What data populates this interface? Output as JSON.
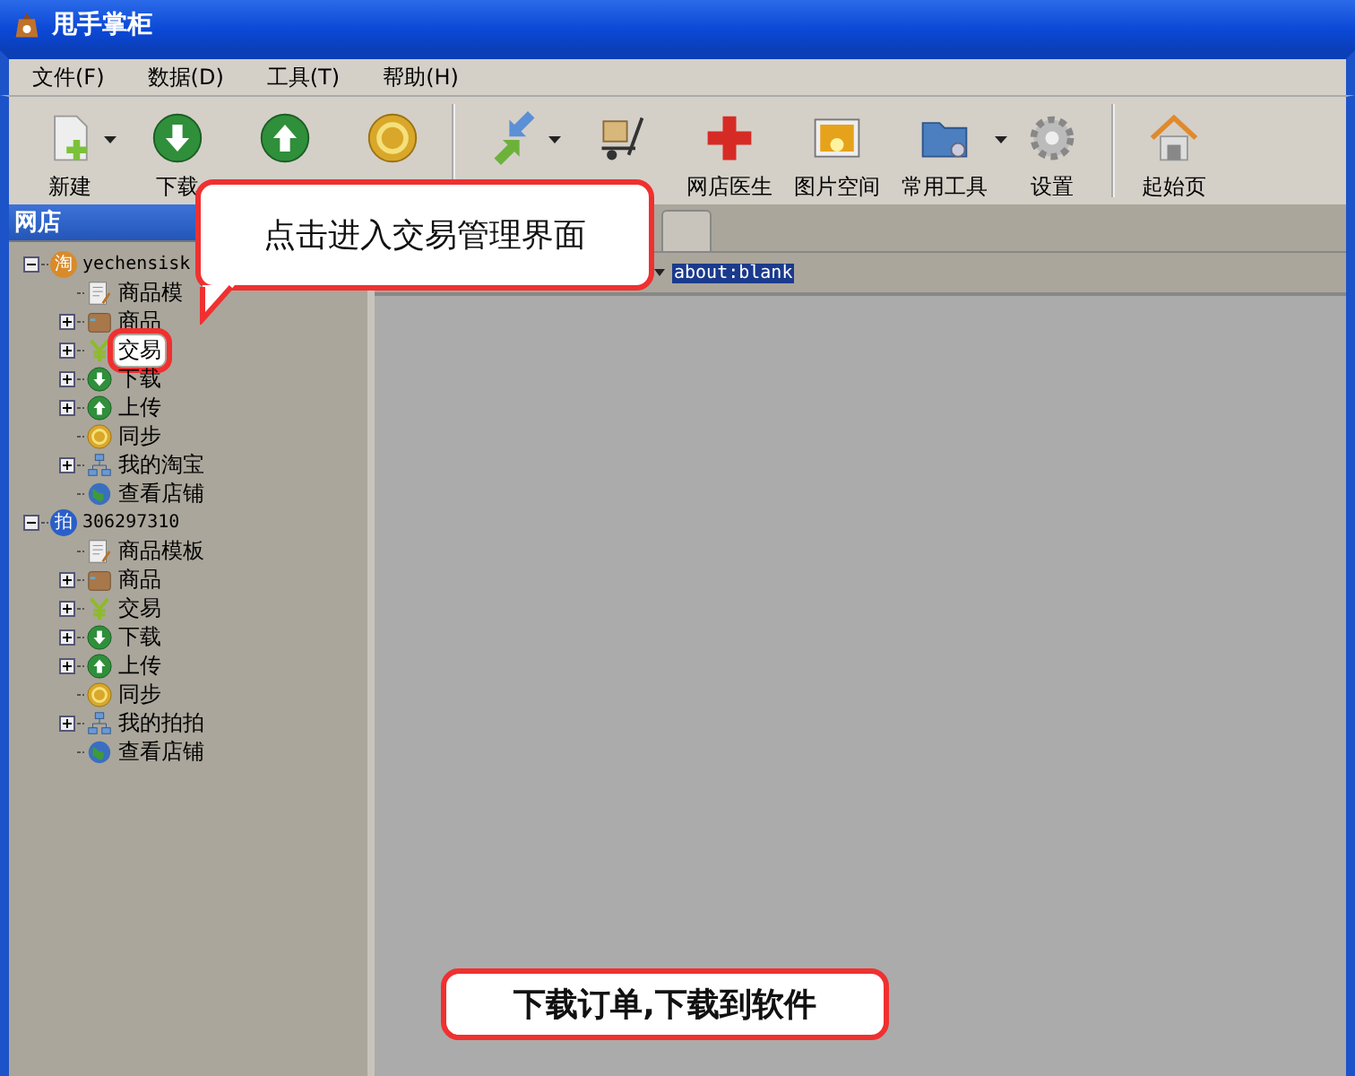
{
  "window": {
    "title": "甩手掌柜"
  },
  "menu": [
    "文件(F)",
    "数据(D)",
    "工具(T)",
    "帮助(H)"
  ],
  "toolbar": [
    {
      "kind": "new",
      "label": "新建",
      "dropdown": true
    },
    {
      "kind": "download",
      "label": "下载",
      "dropdown": false
    },
    {
      "kind": "upload",
      "dropdown": false
    },
    {
      "kind": "sync",
      "dropdown": false
    },
    {
      "kind": "separator"
    },
    {
      "kind": "arrows",
      "dropdown": true
    },
    {
      "kind": "cart",
      "dropdown": false
    },
    {
      "kind": "cross",
      "label": "网店医生",
      "dropdown": false
    },
    {
      "kind": "photo",
      "label": "图片空间",
      "dropdown": false
    },
    {
      "kind": "folder",
      "label": "常用工具",
      "dropdown": true
    },
    {
      "kind": "gear",
      "label": "设置",
      "dropdown": false
    },
    {
      "kind": "separator"
    },
    {
      "kind": "home",
      "label": "起始页",
      "dropdown": false
    }
  ],
  "sidebar": {
    "title": "网店",
    "accounts": [
      {
        "badge": "淘",
        "color": "#d98a2a",
        "name": "yechensisk",
        "expanded": true,
        "children": [
          {
            "label": "商品模",
            "kind": "template",
            "expandable": false,
            "highlighted": false
          },
          {
            "label": "商品",
            "kind": "goods",
            "expandable": true,
            "expanded": false,
            "highlighted": false
          },
          {
            "label": "交易",
            "kind": "trade",
            "expandable": true,
            "expanded": false,
            "highlighted": true
          },
          {
            "label": "下载",
            "kind": "download",
            "expandable": true,
            "expanded": false,
            "highlighted": false
          },
          {
            "label": "上传",
            "kind": "upload",
            "expandable": true,
            "expanded": false,
            "highlighted": false
          },
          {
            "label": "同步",
            "kind": "sync",
            "expandable": false,
            "highlighted": false
          },
          {
            "label": "我的淘宝",
            "kind": "network",
            "expandable": true,
            "expanded": false,
            "highlighted": false
          },
          {
            "label": "查看店铺",
            "kind": "globe",
            "expandable": false,
            "highlighted": false
          }
        ]
      },
      {
        "badge": "拍",
        "color": "#2a5fc9",
        "name": "306297310",
        "expanded": true,
        "children": [
          {
            "label": "商品模板",
            "kind": "template",
            "expandable": false,
            "highlighted": false
          },
          {
            "label": "商品",
            "kind": "goods",
            "expandable": true,
            "expanded": false,
            "highlighted": false
          },
          {
            "label": "交易",
            "kind": "trade",
            "expandable": true,
            "expanded": false,
            "highlighted": false
          },
          {
            "label": "下载",
            "kind": "download",
            "expandable": true,
            "expanded": false,
            "highlighted": false
          },
          {
            "label": "上传",
            "kind": "upload",
            "expandable": true,
            "expanded": false,
            "highlighted": false
          },
          {
            "label": "同步",
            "kind": "sync",
            "expandable": false,
            "highlighted": false
          },
          {
            "label": "我的拍拍",
            "kind": "network",
            "expandable": true,
            "expanded": false,
            "highlighted": false
          },
          {
            "label": "查看店铺",
            "kind": "globe",
            "expandable": false,
            "highlighted": false
          }
        ]
      }
    ]
  },
  "browser": {
    "address": "about:blank"
  },
  "callouts": [
    {
      "text": "点击进入交易管理界面",
      "kind": "pointer"
    },
    {
      "text": "下载订单,下载到软件",
      "kind": "plain"
    }
  ]
}
